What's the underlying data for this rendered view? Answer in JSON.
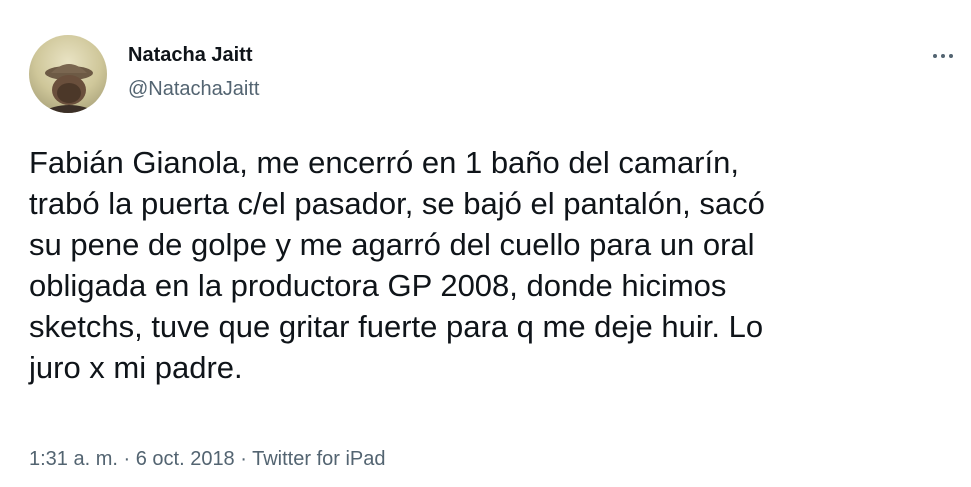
{
  "author": {
    "display_name": "Natacha Jaitt",
    "handle": "@NatachaJaitt",
    "avatar_icon": "profile-photo"
  },
  "more_icon": "more-options-icon",
  "tweet": {
    "lines": [
      "Fabián Gianola, me encerró en 1 baño del camarín,",
      "trabó la puerta c/el pasador, se bajó el pantalón, sacó",
      "su pene de golpe y me agarró del cuello para un oral",
      "obligada en la productora GP 2008, donde hicimos",
      "sketchs, tuve que gritar fuerte para q me deje huir. Lo",
      "juro x mi padre."
    ]
  },
  "meta": {
    "time": "1:31 a. m.",
    "separator": " · ",
    "date": "6 oct. 2018",
    "source": "Twitter for iPad"
  },
  "colors": {
    "text_primary": "#0f1419",
    "text_secondary": "#536471",
    "background": "#ffffff"
  }
}
